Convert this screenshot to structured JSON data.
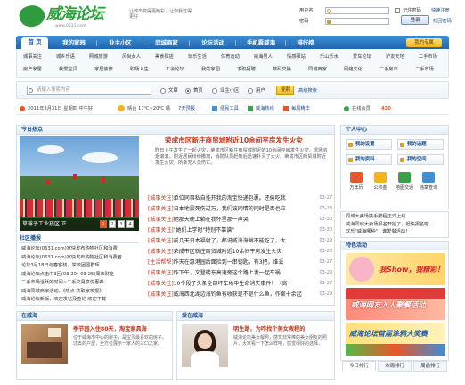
{
  "header": {
    "logo_text": "威海论坛",
    "logo_sub": "让城市变得更精彩，让你我过得更好",
    "logo_url": "www.0631.com",
    "login": {
      "user_label": "用户名",
      "pass_label": "密码",
      "remember_label": "记住密码",
      "quick_register": "快速注册",
      "login_button": "登录",
      "forgot": "找回密码"
    }
  },
  "nav": {
    "items": [
      {
        "label": "首 页"
      },
      {
        "label": "我的家园"
      },
      {
        "label": "业主小区"
      },
      {
        "label": "同城商家"
      },
      {
        "label": "论坛活动"
      },
      {
        "label": "手机看威海"
      },
      {
        "label": "排行榜"
      }
    ],
    "theme_button": "我的专属"
  },
  "subnav": {
    "row1": [
      "城事关注",
      "城乡乐语",
      "照城旅游",
      "风尚女人",
      "美食探店",
      "玩乐生活",
      "体育运动",
      "威海男人",
      "情感驿站",
      "乐山乐水",
      "爱车论坛",
      "驴友天地",
      "二手市场"
    ],
    "row2": [
      "房产家居",
      "我爱宝贝",
      "家居装修",
      "职场人生",
      "工会论坛",
      "我的家园",
      "求职招聘",
      "数码交换",
      "同城商家",
      "网络文化",
      "二手房市",
      "二手市场"
    ]
  },
  "search": {
    "placeholder": "请输入搜索内容",
    "options": [
      "文章",
      "首页",
      "业主小区",
      "用户"
    ],
    "button": "搜索",
    "advanced": "高级搜索"
  },
  "infobar": {
    "date": "2011年3月31日 星期四 中午好",
    "weather": "晴台 17℃~20℃ 晴",
    "forecast": "7天预报",
    "tools": "便民工具",
    "hotline": "威海热线",
    "feedback": "每周精华",
    "online_label": "在线会员",
    "online_count": "430"
  },
  "today": {
    "title": "今日热点",
    "caption": "草莓子工业孩区 正",
    "pages": [
      "1",
      "2",
      "3",
      "4"
    ],
    "headline": "荣成市区新庄商贸城附近10余间平房发生火灾",
    "lead": "昨日上午发生了一起火灾，荣成市区新庄商贸城附近的10余间平房发生火灾，现场浓烟滚滚，附近居民纷纷撤离，消防队员赶到后迅速扑灭了大火。荣成市区商贸城附近发生火灾，所幸无人员伤亡。",
    "news": [
      {
        "cat": "[城事关注]",
        "text": "单位同事私自挂开我的淘宝快递包裹。还偷吃我",
        "date": "03-27"
      },
      {
        "cat": "[城事关注]",
        "text": "日本地震死伤过万，我们该同情的同时是否也应",
        "date": "03-28"
      },
      {
        "cat": "[城事关注]",
        "text": "她那天晚上躺在我怀里那一声哭",
        "date": "03-30"
      },
      {
        "cat": "[城事关注]",
        "text": "\"她们上学时\"特别不靠谱\"",
        "date": "03-30"
      },
      {
        "cat": "[城事关注]",
        "text": "前几天日本福射了，都说威海海鲜不能吃了，大",
        "date": "03-29"
      },
      {
        "cat": "[城事关注]",
        "text": "荣成市区新庄商贸城附近10余间平房发生火灾",
        "date": "03-28"
      },
      {
        "cat": "[生活帮帮]",
        "text": "昨天在惠港园后面捡到一串钥匙，有3把，谁丢",
        "date": "03-27"
      },
      {
        "cat": "[城事关注]",
        "text": "昨下午，文登楼东高速旁这个路上发一起车祸",
        "date": "03-29"
      },
      {
        "cat": "[城事关注]",
        "text": "10个段子头条全部坏车场中生命消失事件！（高",
        "date": "03-27"
      },
      {
        "cat": "[城事关注]",
        "text": "威海西北湖边海钓鱼有收获是不是什么鱼，作案十余起",
        "date": "03-29"
      }
    ]
  },
  "community": {
    "title": "社区播报",
    "items": [
      "威海论坛(0631.com)家快发布购物社区和消费",
      "威海论坛(0631.com)家快发布购物社区和消费者...",
      "论坛3月18日与春客栈，学校团圆群晖",
      "威海论坛点击中3回(03-20~03-25)周末财金",
      "二手市场活跃的时间~二手交易享优惠券",
      "威海同城商家活动，《热点 获取家校报》",
      "威海论坛新版，欢迎发帖及查论 欢迎下载"
    ]
  },
  "bottom": {
    "left_header": "在威海",
    "left_title": "季节园入住80天，淘宝家具海",
    "left_desc": "位于威海市中心的房子，是宝贝最喜欢的房子。过去的户型，全方位展示一家人的三口之家。",
    "mid_header": "爱在威海",
    "mid_title": "明生路，为咋找个美女教程的",
    "mid_desc": "威海论坛美女靓照，感觉非常棒的美女朋友的照片，大家看一下怎么样吧，感觉很好的选择。"
  },
  "right": {
    "personal_title": "个人中心",
    "quick_buttons": [
      "我的设置",
      "我的话题",
      "我的资料",
      "我的空间"
    ],
    "tools": [
      "万年历",
      "公积金",
      "地图交通",
      "违章查询"
    ],
    "events": [
      "同城大卖场携手鹏程正式上线",
      "威海同城大卖场报名开始了，赶快报名吧",
      "欢乐\"威海哪种\"，谁爱做活动！"
    ],
    "special_title": "特色活动",
    "ads": [
      "我Show，我精彩！",
      "威海网友入人聚餐活动",
      "威海论坛首届涂鸦大奖赛"
    ],
    "tabs": [
      "今日排行",
      "本周排行",
      "周前排行"
    ]
  }
}
